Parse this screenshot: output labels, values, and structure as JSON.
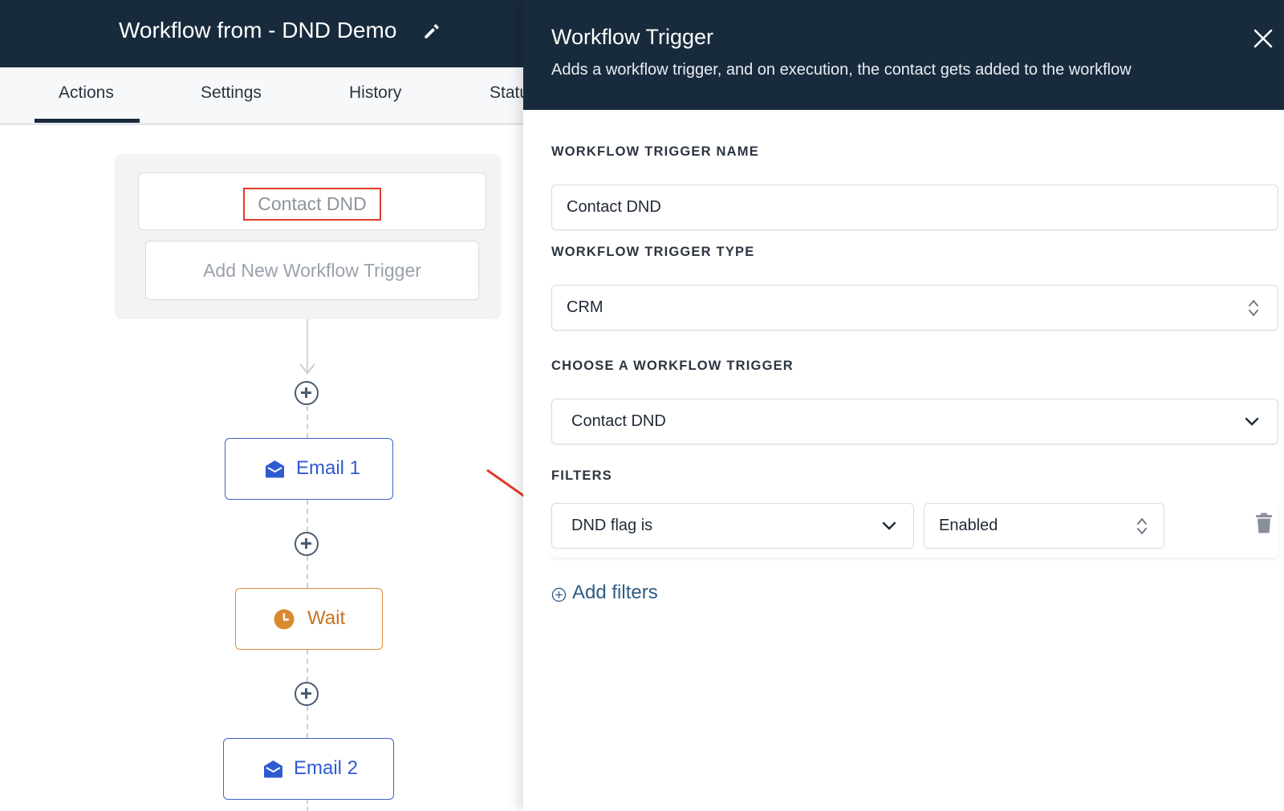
{
  "header": {
    "title": "Workflow from - DND Demo",
    "edit_icon": "pencil-icon",
    "background": "#182b3c"
  },
  "tabs": [
    {
      "label": "Actions",
      "active": true
    },
    {
      "label": "Settings",
      "active": false
    },
    {
      "label": "History",
      "active": false
    },
    {
      "label": "Statu",
      "active": false
    }
  ],
  "canvas": {
    "trigger": {
      "label": "Contact DND",
      "highlighted": true,
      "highlight_color": "#e03a2a"
    },
    "add_trigger_label": "Add New Workflow Trigger",
    "nodes": [
      {
        "type": "email",
        "label": "Email 1",
        "icon": "envelope-icon",
        "color": "#2f5bd0"
      },
      {
        "type": "wait",
        "label": "Wait",
        "icon": "clock-icon",
        "color": "#d98a2f"
      },
      {
        "type": "email",
        "label": "Email 2",
        "icon": "envelope-icon",
        "color": "#2f5bd0"
      }
    ],
    "add_step_icon": "plus-circle-icon"
  },
  "panel": {
    "title": "Workflow Trigger",
    "subtitle": "Adds a workflow trigger, and on execution, the contact gets added to the workflow",
    "close_icon": "close-icon",
    "trigger_name": {
      "label": "WORKFLOW TRIGGER NAME",
      "value": "Contact DND"
    },
    "trigger_type": {
      "label": "WORKFLOW TRIGGER TYPE",
      "value": "CRM"
    },
    "choose_trigger": {
      "label": "CHOOSE A WORKFLOW TRIGGER",
      "value": "Contact DND"
    },
    "filters": {
      "label": "FILTERS",
      "items": [
        {
          "field": "DND flag is",
          "value": "Enabled"
        }
      ],
      "delete_icon": "trash-icon",
      "add_label": "Add filters",
      "annotation_arrow_color": "#e03a2a"
    }
  }
}
